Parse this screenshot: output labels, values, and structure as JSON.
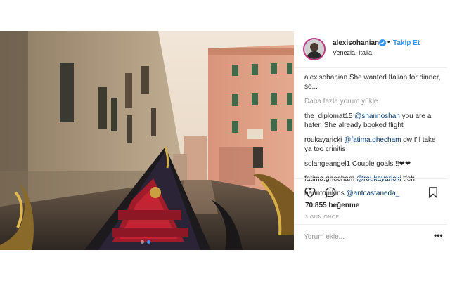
{
  "header": {
    "username": "alexisohanian",
    "separator": "•",
    "follow_label": "Takip Et",
    "location": "Venezia, Italia"
  },
  "caption": {
    "username": "alexisohanian",
    "text": "She wanted Italian for dinner, so..."
  },
  "load_more": "Daha fazla yorum yükle",
  "comments": [
    {
      "username": "the_diplomat15",
      "mention": "@shannoshan",
      "text": "you are a hater. She already booked flight"
    },
    {
      "username": "roukayaricki",
      "mention": "@fatima.ghecham",
      "text": "dw I'll take ya too crinitis"
    },
    {
      "username": "solangeangel1",
      "mention": "",
      "text": "Couple goals!!!❤❤"
    },
    {
      "username": "fatima.ghecham",
      "mention": "@roukayaricki",
      "text": "tfeh"
    },
    {
      "username": "hanntomkins",
      "mention": "@antcastaneda_",
      "text": ""
    }
  ],
  "likes": "70.855 beğenme",
  "time_ago": "3 GÜN ÖNCE",
  "add_comment_placeholder": "Yorum ekle...",
  "options_label": "•••",
  "icons": [
    "heart-icon",
    "comment-icon",
    "bookmark-icon",
    "verified-badge-icon"
  ],
  "colors": {
    "follow": "#3897f0",
    "mention": "#003569",
    "muted": "#999999",
    "active_dot": "#3897f0"
  }
}
